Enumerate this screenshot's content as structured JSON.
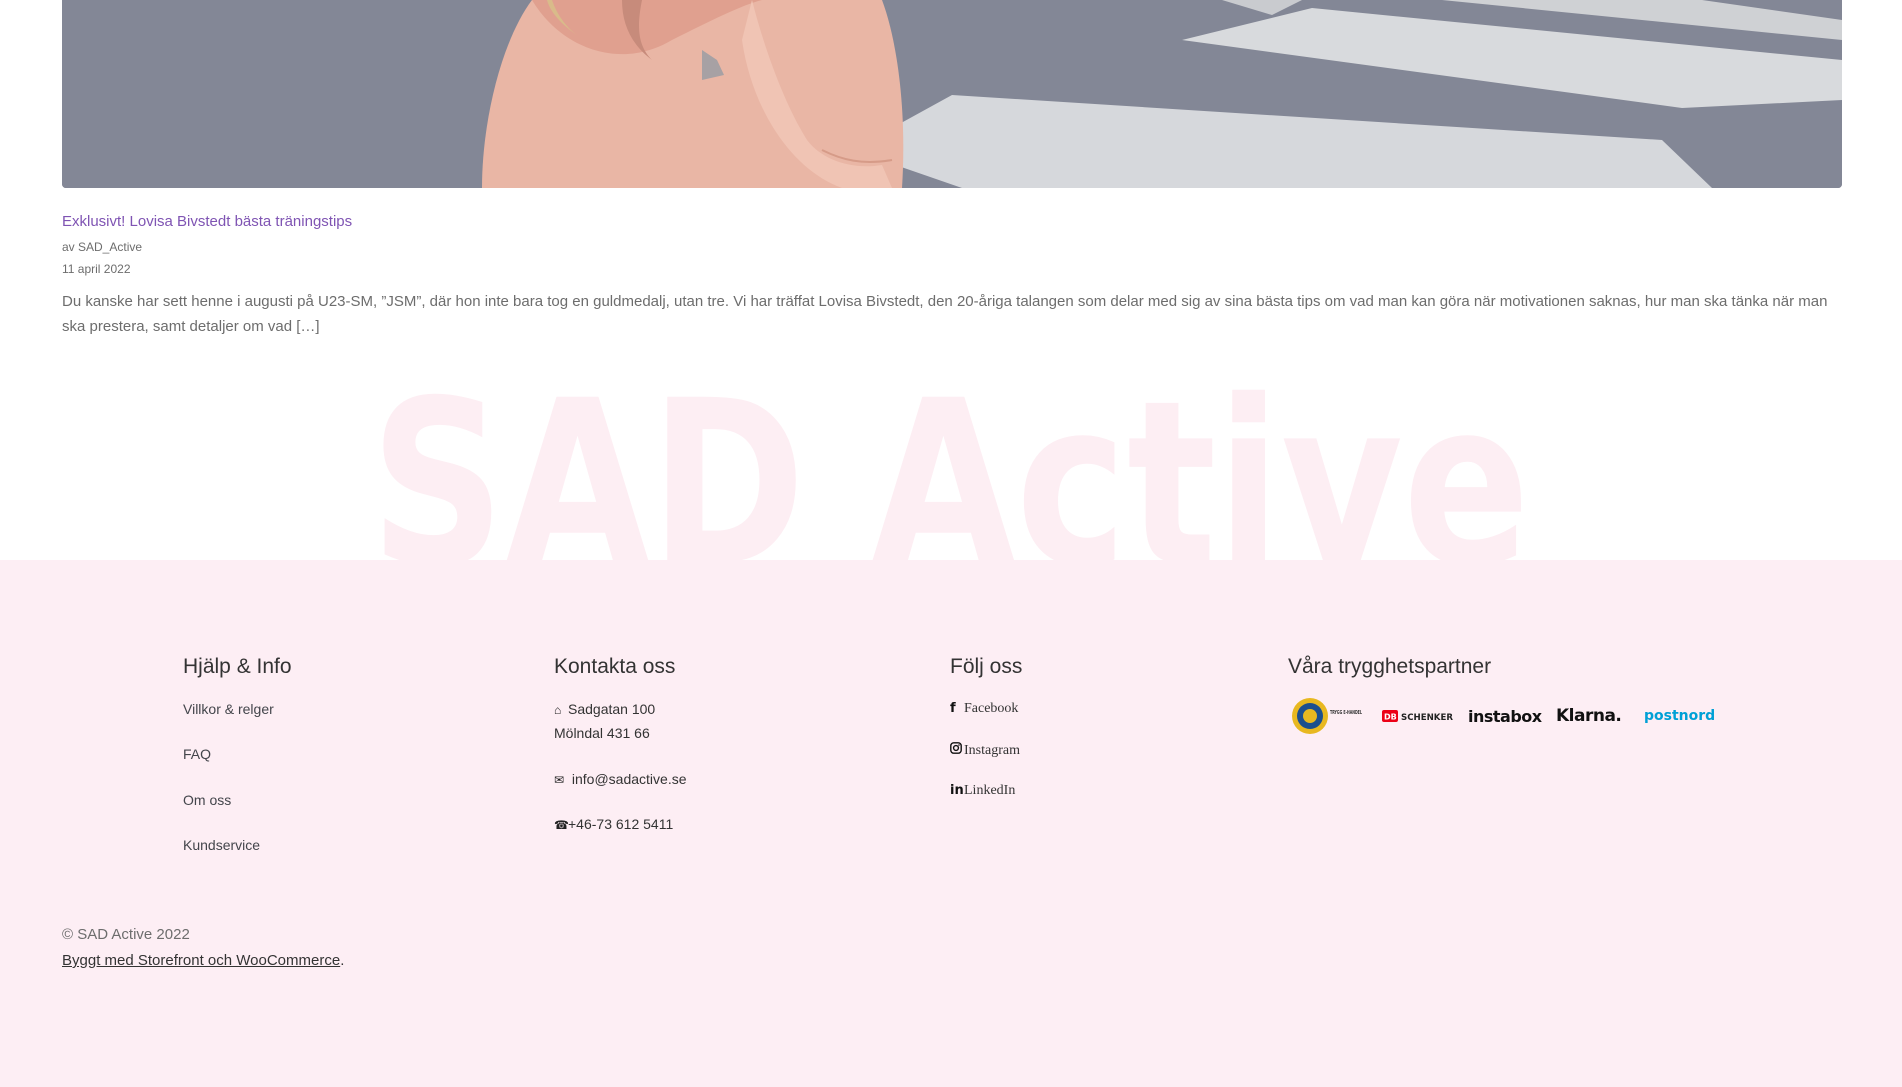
{
  "post": {
    "title": "Exklusivt! Lovisa Bivstedt bästa träningstips",
    "author": "av SAD_Active",
    "date": "11 april 2022",
    "excerpt": "Du kanske har sett henne i augusti på U23-SM, ”JSM”, där hon inte bara tog en guldmedalj, utan tre. Vi har träffat Lovisa Bivstedt, den 20-åriga talangen som delar med sig av sina bästa tips om vad man kan göra när motivationen saknas, hur man ska tänka när man ska prestera, samt detaljer om vad […]"
  },
  "watermark": {
    "text": "SAD Active"
  },
  "footer": {
    "help": {
      "heading": "Hjälp & Info",
      "links": [
        "Villkor & relger",
        "FAQ",
        "Om oss",
        "Kundservice"
      ]
    },
    "contact": {
      "heading": "Kontakta oss",
      "address_line1": "Sadgatan 100",
      "address_line2": "Mölndal 431 66",
      "email": "info@sadactive.se",
      "phone": "+46-73 612 5411"
    },
    "follow": {
      "heading": "Följ oss",
      "links": [
        "Facebook",
        "Instagram",
        "LinkedIn"
      ]
    },
    "partners": {
      "heading": "Våra trygghetspartner",
      "logos": [
        {
          "name": "trygg-ehandel",
          "text": "TRYGG E-HANDEL"
        },
        {
          "name": "db-schenker",
          "badge": "DB",
          "text": "SCHENKER"
        },
        {
          "name": "instabox",
          "text": "instabox"
        },
        {
          "name": "klarna",
          "text": "Klarna."
        },
        {
          "name": "postnord",
          "text": "postnord"
        }
      ]
    },
    "copyright": "© SAD Active 2022",
    "credit_link": "Byggt med Storefront och WooCommerce",
    "credit_suffix": "."
  },
  "colors": {
    "footer_bg": "#fdeef4",
    "watermark": "#fdeef3",
    "post_title": "#7f54b3",
    "postnord": "#00a0d6",
    "schenker_red": "#ec0016"
  },
  "icons": {
    "address": "house-icon",
    "email": "envelope-icon",
    "phone": "phone-icon",
    "facebook": "facebook-icon",
    "instagram": "instagram-icon",
    "linkedin": "linkedin-icon"
  }
}
